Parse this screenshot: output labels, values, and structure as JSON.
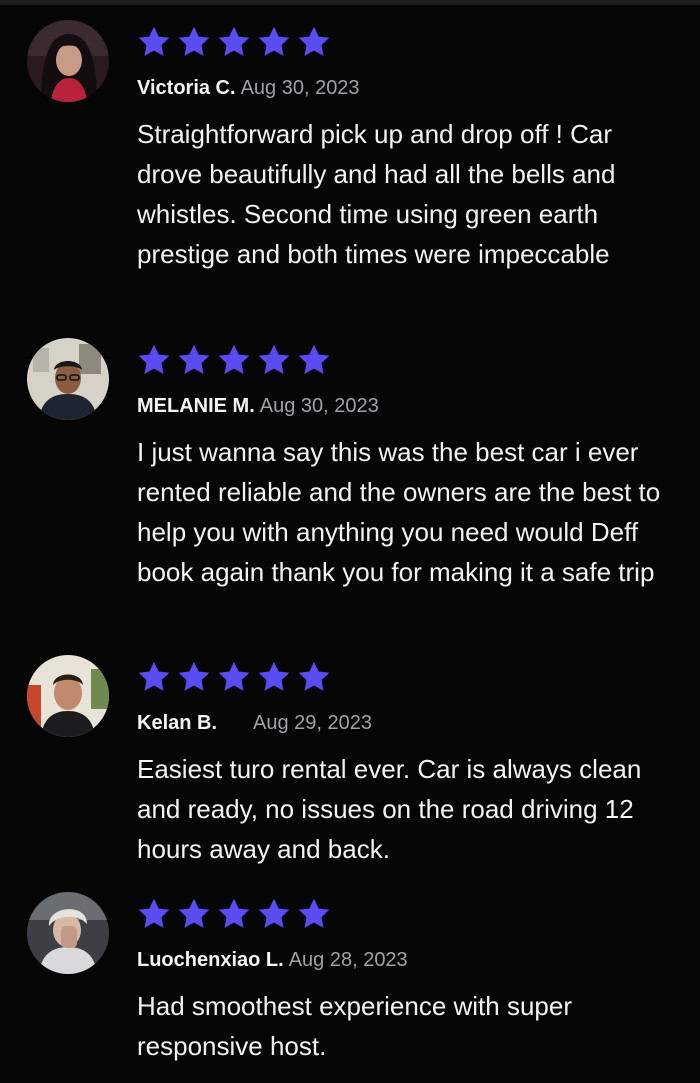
{
  "colors": {
    "background": "#050506",
    "star": "#5a4bf2",
    "name": "#f4f4f6",
    "date": "#a1a1a8",
    "text": "#f3f3f5"
  },
  "reviews": [
    {
      "reviewer": "Victoria C.",
      "date": "Aug 30, 2023",
      "rating": 5,
      "text": "Straightforward pick up and drop off ! Car drove beautifully and had all the bells and whistles. Second time using green earth prestige and both times were impeccable"
    },
    {
      "reviewer": "MELANIE M.",
      "date": "Aug 30, 2023",
      "rating": 5,
      "text": "I just wanna say this was the best car i ever rented reliable and the owners are the best to help you with anything you need would Deff book again thank you for making it a safe trip"
    },
    {
      "reviewer": "Kelan B.",
      "date": "Aug 29, 2023",
      "rating": 5,
      "text": "Easiest turo rental ever. Car is always clean and ready, no issues on the road driving 12 hours away and back."
    },
    {
      "reviewer": "Luochenxiao L.",
      "date": "Aug 28, 2023",
      "rating": 5,
      "text": "Had smoothest experience with super responsive host."
    }
  ]
}
